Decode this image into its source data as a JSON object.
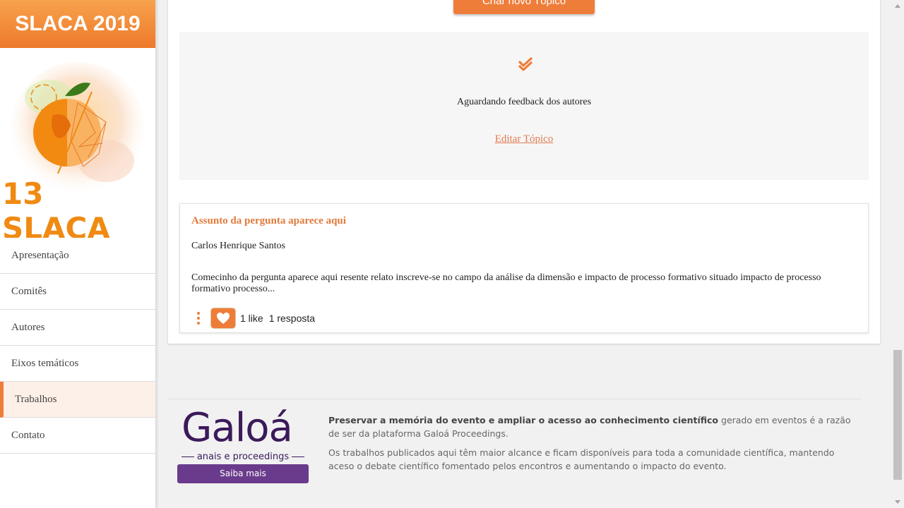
{
  "sidebar": {
    "brand": "SLACA 2019",
    "logo_text": "13 SLACA",
    "items": [
      {
        "label": "Apresentação"
      },
      {
        "label": "Comitês"
      },
      {
        "label": "Autores"
      },
      {
        "label": "Eixos temáticos"
      },
      {
        "label": "Trabalhos",
        "active": true
      },
      {
        "label": "Contato"
      }
    ]
  },
  "main": {
    "create_topic_label": "Criar novo Tópico",
    "status": {
      "icon": "double-check-icon",
      "text": "Aguardando feedback dos autores",
      "edit_link": "Editar Tópico"
    },
    "question": {
      "title": "Assunto da pergunta aparece aqui",
      "author": "Carlos Henrique Santos",
      "body": "Comecinho da pergunta aparece aqui resente relato inscreve-se no campo da análise da dimensão e impacto de processo formativo situado impacto de processo formativo processo...",
      "likes": "1 like",
      "replies": "1 resposta"
    }
  },
  "footer": {
    "brand": "Galoá",
    "brand_sub": "anais e proceedings",
    "saiba_mais": "Saiba mais",
    "text1_bold": "Preservar a memória do evento e ampliar o acesso ao conhecimento científico",
    "text1_rest": " gerado em eventos é a razão de ser da plataforma Galoá Proceedings.",
    "text2": "Os trabalhos publicados aqui têm maior alcance e ficam disponíveis para toda a comunidade científica, mantendo aceso o debate científico fomentado pelos encontros e aumentando o impacto do evento."
  },
  "colors": {
    "accent": "#ef7d3a",
    "brand_purple": "#6a3b8c"
  }
}
